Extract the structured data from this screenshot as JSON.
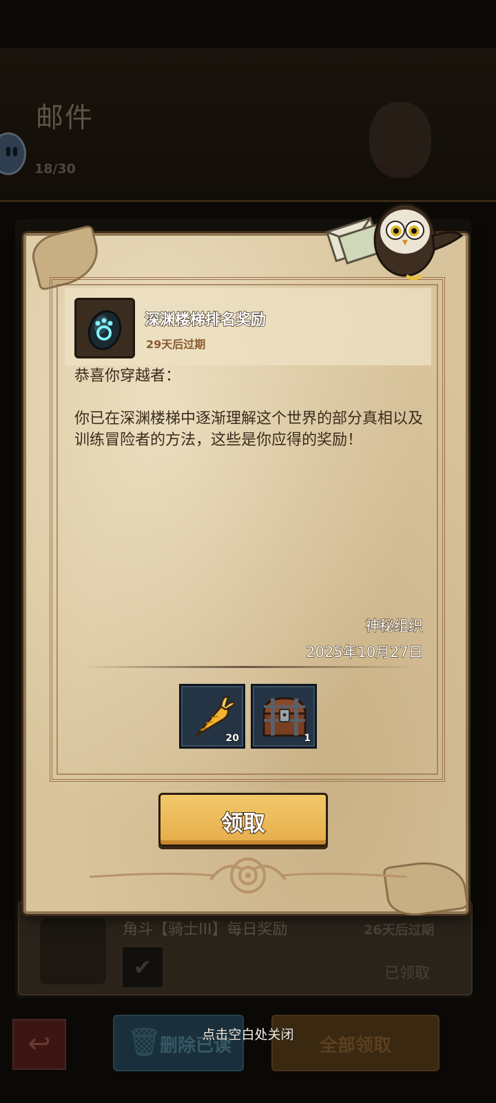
{
  "background": {
    "title": "邮件",
    "count": "18/30",
    "list_item": {
      "title": "角斗【骑士III】每日奖励",
      "expiry": "26天后过期",
      "status": "已领取"
    },
    "buttons": {
      "delete_label": "删除已读",
      "claim_all_label": "全部领取"
    }
  },
  "mail": {
    "title": "深渊楼梯排名奖励",
    "expiry": "29天后过期",
    "body": "恭喜你穿越者：\n\n你已在深渊楼梯中逐渐理解这个世界的部分真相以及训练冒险者的方法，这些是你应得的奖励！",
    "sender": "神秘组织",
    "date": "2025年10月27日",
    "icon": "abyss-stone-icon",
    "rewards": [
      {
        "icon": "golden-carrot-icon",
        "quantity": "20"
      },
      {
        "icon": "treasure-chest-icon",
        "quantity": "1"
      }
    ],
    "claim_label": "领取"
  },
  "close_hint": "点击空白处关闭",
  "colors": {
    "parchment": "#d8c49c",
    "claim_button": "#f2c86a",
    "reward_slot": "#243444"
  }
}
